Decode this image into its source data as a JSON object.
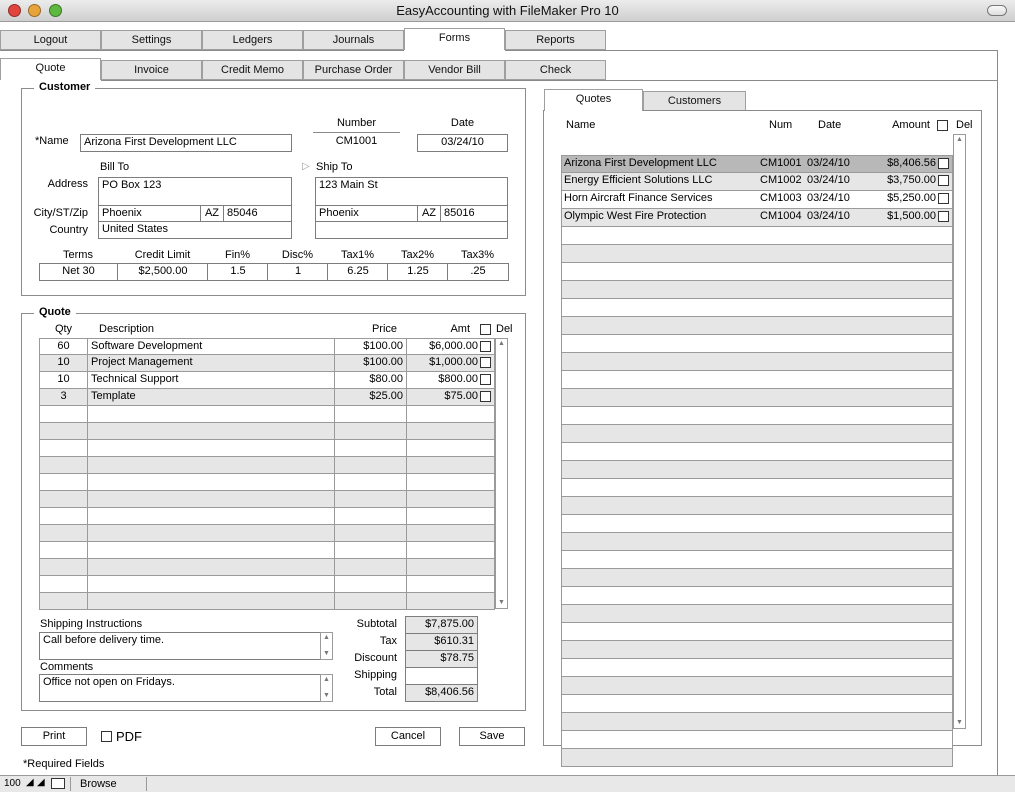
{
  "window": {
    "title": "EasyAccounting with FileMaker Pro 10"
  },
  "main_tabs": [
    "Logout",
    "Settings",
    "Ledgers",
    "Journals",
    "Forms",
    "Reports"
  ],
  "form_tabs": [
    "Quote",
    "Invoice",
    "Credit Memo",
    "Purchase Order",
    "Vendor Bill",
    "Check"
  ],
  "customer": {
    "heading": "Customer",
    "name_label": "*Name",
    "name": "Arizona First Development LLC",
    "number_label": "Number",
    "number": "CM1001",
    "date_label": "Date",
    "date": "03/24/10",
    "bill_to_label": "Bill To",
    "ship_to_label": "Ship To",
    "address_label": "Address",
    "city_label": "City/ST/Zip",
    "country_label": "Country",
    "bill": {
      "address": "PO Box 123",
      "city": "Phoenix",
      "state": "AZ",
      "zip": "85046",
      "country": "United States"
    },
    "ship": {
      "address": "123 Main St",
      "city": "Phoenix",
      "state": "AZ",
      "zip": "85016",
      "country": ""
    },
    "terms_headers": [
      "Terms",
      "Credit Limit",
      "Fin%",
      "Disc%",
      "Tax1%",
      "Tax2%",
      "Tax3%"
    ],
    "terms_values": [
      "Net 30",
      "$2,500.00",
      "1.5",
      "1",
      "6.25",
      "1.25",
      ".25"
    ]
  },
  "quote": {
    "heading": "Quote",
    "col_qty": "Qty",
    "col_desc": "Description",
    "col_price": "Price",
    "col_amt": "Amt",
    "col_del": "Del",
    "lines": [
      {
        "qty": "60",
        "desc": "Software Development",
        "price": "$100.00",
        "amt": "$6,000.00"
      },
      {
        "qty": "10",
        "desc": "Project Management",
        "price": "$100.00",
        "amt": "$1,000.00"
      },
      {
        "qty": "10",
        "desc": "Technical Support",
        "price": "$80.00",
        "amt": "$800.00"
      },
      {
        "qty": "3",
        "desc": "Template",
        "price": "$25.00",
        "amt": "$75.00"
      }
    ],
    "shipping_label": "Shipping Instructions",
    "shipping": "Call before delivery time.",
    "comments_label": "Comments",
    "comments": "Office not open on Fridays.",
    "subtotal_label": "Subtotal",
    "subtotal": "$7,875.00",
    "tax_label": "Tax",
    "tax": "$610.31",
    "discount_label": "Discount",
    "discount": "$78.75",
    "shipping_cost_label": "Shipping",
    "shipping_cost": "",
    "total_label": "Total",
    "total": "$8,406.56"
  },
  "buttons": {
    "print": "Print",
    "pdf": "PDF",
    "cancel": "Cancel",
    "save": "Save"
  },
  "footer_note": "*Required Fields",
  "right_tabs": [
    "Quotes",
    "Customers"
  ],
  "quotes_list": {
    "col_name": "Name",
    "col_num": "Num",
    "col_date": "Date",
    "col_amount": "Amount",
    "col_del": "Del",
    "rows": [
      {
        "name": "Arizona First Development LLC",
        "num": "CM1001",
        "date": "03/24/10",
        "amount": "$8,406.56"
      },
      {
        "name": "Energy Efficient Solutions LLC",
        "num": "CM1002",
        "date": "03/24/10",
        "amount": "$3,750.00"
      },
      {
        "name": "Horn Aircraft Finance Services",
        "num": "CM1003",
        "date": "03/24/10",
        "amount": "$5,250.00"
      },
      {
        "name": "Olympic West Fire Protection",
        "num": "CM1004",
        "date": "03/24/10",
        "amount": "$1,500.00"
      }
    ]
  },
  "status": {
    "zoom": "100",
    "mode": "Browse"
  },
  "colors": {
    "close": "#e0443c",
    "minimize": "#e8a43a",
    "maximize": "#5cb83e",
    "selected_row": "#b8b8b8",
    "alt_row": "#e6e6e6"
  }
}
